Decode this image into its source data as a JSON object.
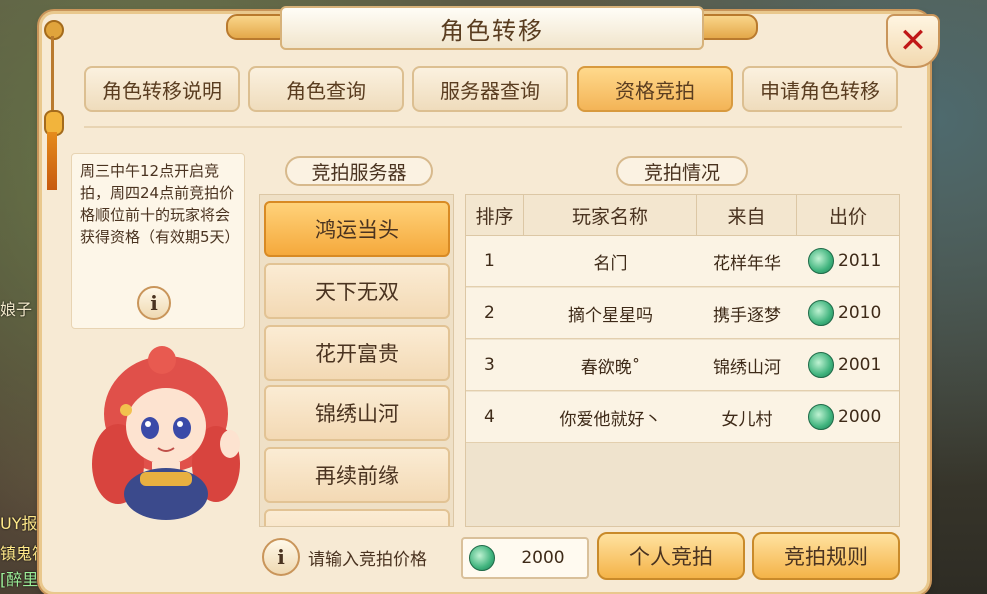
{
  "window": {
    "title": "角色转移",
    "close_label": "✕"
  },
  "tabs": [
    {
      "label": "角色转移说明",
      "active": false
    },
    {
      "label": "角色查询",
      "active": false
    },
    {
      "label": "服务器查询",
      "active": false
    },
    {
      "label": "资格竞拍",
      "active": true
    },
    {
      "label": "申请角色转移",
      "active": false
    }
  ],
  "info": {
    "text": "周三中午12点开启竞拍，周四24点前竞拍价格顺位前十的玩家将会获得资格（有效期5天）",
    "icon_glyph": "i"
  },
  "servers": {
    "label": "竞拍服务器",
    "items": [
      {
        "name": "鸿运当头",
        "active": true
      },
      {
        "name": "天下无双",
        "active": false
      },
      {
        "name": "花开富贵",
        "active": false
      },
      {
        "name": "锦绣山河",
        "active": false
      },
      {
        "name": "再续前缘",
        "active": false
      }
    ]
  },
  "auction": {
    "label": "竞拍情况",
    "headers": [
      "排序",
      "玩家名称",
      "来自",
      "出价"
    ],
    "rows": [
      {
        "rank": "1",
        "player": "名门",
        "from": "花样年华",
        "bid": "2011"
      },
      {
        "rank": "2",
        "player": "摘个星星吗",
        "from": "携手逐梦",
        "bid": "2010"
      },
      {
        "rank": "3",
        "player": "春欲晚˚",
        "from": "锦绣山河",
        "bid": "2001"
      },
      {
        "rank": "4",
        "player": "你爱他就好丶",
        "from": "女儿村",
        "bid": "2000"
      }
    ]
  },
  "bottom": {
    "hint_glyph": "i",
    "hint": "请输入竞拍价格",
    "price": "2000",
    "bid_button": "个人竞拍",
    "rules_button": "竞拍规则"
  },
  "background_text": {
    "left1": "娘子",
    "left2": "UY报",
    "left3": "镇鬼符",
    "left4": "[醉里"
  },
  "colors": {
    "accent": "#f4b348",
    "panel": "#f7ead4",
    "close": "#c01818",
    "coin": "#3fb37d"
  }
}
